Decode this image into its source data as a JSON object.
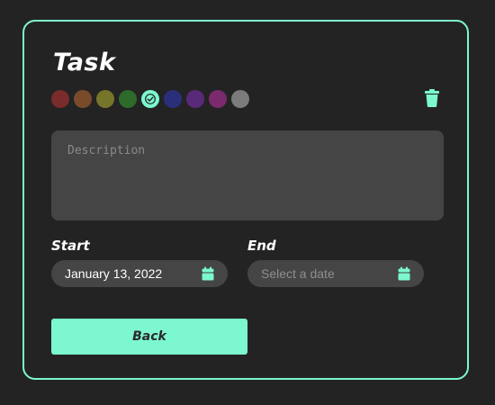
{
  "card": {
    "title": "Task",
    "accent_color": "#7cf7cf"
  },
  "colors": [
    {
      "name": "red",
      "hex": "#7a2b2b",
      "selected": false
    },
    {
      "name": "brown",
      "hex": "#7a4b2b",
      "selected": false
    },
    {
      "name": "olive",
      "hex": "#77752a",
      "selected": false
    },
    {
      "name": "green",
      "hex": "#2e6b2a",
      "selected": false
    },
    {
      "name": "mint",
      "hex": "#7cf7cf",
      "selected": true
    },
    {
      "name": "navy",
      "hex": "#2b2e7a",
      "selected": false
    },
    {
      "name": "purple",
      "hex": "#5a2a7a",
      "selected": false
    },
    {
      "name": "magenta",
      "hex": "#7a2a6d",
      "selected": false
    },
    {
      "name": "gray",
      "hex": "#7b7b7b",
      "selected": false
    }
  ],
  "description": {
    "placeholder": "Description",
    "value": ""
  },
  "start": {
    "label": "Start",
    "value": "January 13, 2022"
  },
  "end": {
    "label": "End",
    "placeholder": "Select a date"
  },
  "back_button": {
    "label": "Back"
  },
  "icons": {
    "delete": "trash-icon",
    "calendar": "calendar-icon",
    "selected": "check-icon"
  }
}
